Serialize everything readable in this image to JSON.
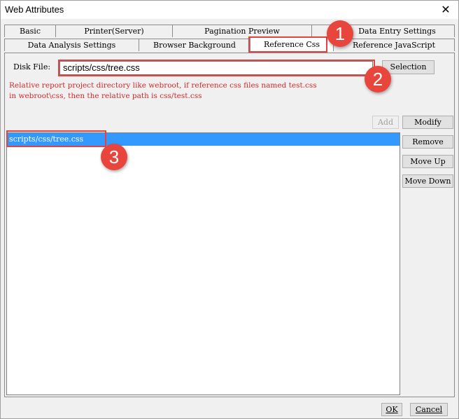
{
  "window": {
    "title": "Web Attributes",
    "close_glyph": "✕"
  },
  "tabs": {
    "row1": [
      "Basic",
      "Printer(Server)",
      "Pagination Preview",
      "Data Entry Settings"
    ],
    "row2": [
      "Data Analysis Settings",
      "Browser Background",
      "Reference Css",
      "Reference JavaScript"
    ],
    "active": "Reference Css"
  },
  "form": {
    "disk_file_label": "Disk File:",
    "disk_file_value": "scripts/css/tree.css",
    "selection_button": "Selection",
    "hint_line1": "Relative report project directory like webroot, if reference css files named test.css",
    "hint_line2": "in webroot\\css, then the relative path is css/test.css"
  },
  "actions": {
    "add": "Add",
    "modify": "Modify",
    "remove": "Remove",
    "move_up": "Move Up",
    "move_down": "Move Down"
  },
  "css_list": [
    "scripts/css/tree.css"
  ],
  "footer": {
    "ok": "OK",
    "cancel": "Cancel"
  },
  "callouts": [
    "1",
    "2",
    "3"
  ],
  "colors": {
    "accent_red": "#e84040",
    "selection_blue": "#3399ff",
    "hint_red": "#d42a2a"
  }
}
